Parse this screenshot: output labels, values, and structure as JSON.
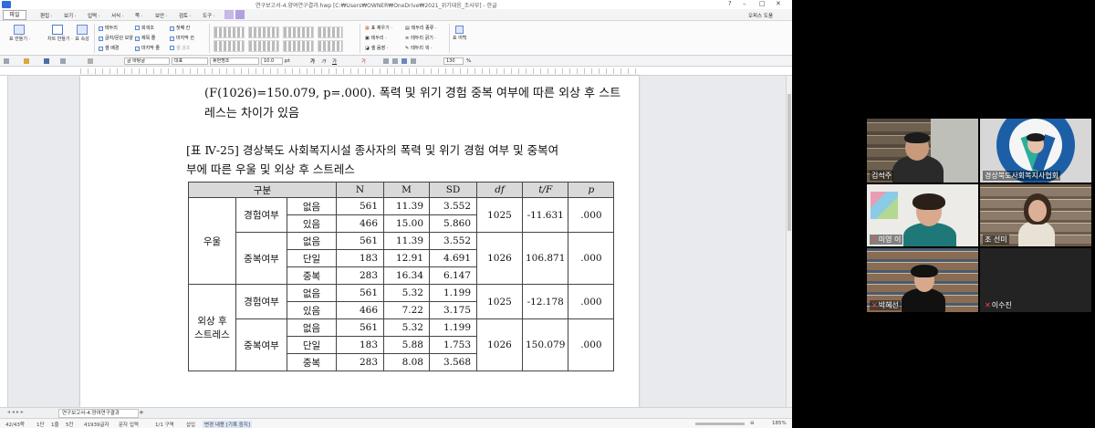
{
  "editor": {
    "window_title": "연구보고서-4.양여연구결과.hwp [C:₩Users₩OWNER₩OneDrive₩2021_위기대응_조사부] - 한글",
    "menu": {
      "file": "파일",
      "items": [
        "편집 ·",
        "보기 ·",
        "입력 ·",
        "서식 ·",
        "쪽 ·",
        "보안 ·",
        "검토 ·",
        "도구 ·"
      ],
      "right_label": "오피스 도움"
    },
    "ribbon": {
      "buttons": [
        "표 만들기 ·",
        "차트 만들기 ·",
        "표 속성"
      ],
      "checks_col1": [
        "테두리",
        "글자/문단 모양",
        "셀 배경"
      ],
      "checks_col2": [
        "회색조",
        "제목 줄",
        "마지막 줄"
      ],
      "checks_col3": [
        "첫째 칸",
        "마지막 칸",
        "셀 강조"
      ],
      "right_items": [
        "표 채우기 ·",
        "테두리 ·",
        "셀 음영 ·",
        "테두리 종류 ·",
        "테두리 굵기 ·",
        "테두리 색 ·"
      ],
      "last_button": "표 여백"
    },
    "formatbar": {
      "style": "글 바탕글",
      "lang": "대표",
      "font": "휴먼명조",
      "size": "10.0",
      "unit": "pt",
      "zoom": "130",
      "zoom_unit": "%"
    },
    "document": {
      "line1": "(F(1026)=150.079, p=.000). 폭력 및 위기 경험 중복 여부에 따른 외상 후 스트",
      "line2": "레스는 차이가 있음",
      "caption1": "[표 Ⅳ-25] 경상북도 사회복지시설 종사자의 폭력 및 위기 경험 여부 및 중복여",
      "caption2": "부에 따른 우울 및 외상 후 스트레스"
    },
    "table": {
      "headers": [
        "구분",
        "N",
        "M",
        "SD",
        "df",
        "t/F",
        "p"
      ],
      "groups": [
        {
          "label": "우울",
          "subgroups": [
            {
              "label": "경험여부",
              "rows": [
                {
                  "cat": "없음",
                  "n": "561",
                  "m": "11.39",
                  "sd": "3.552"
                },
                {
                  "cat": "있음",
                  "n": "466",
                  "m": "15.00",
                  "sd": "5.860"
                }
              ],
              "df": "1025",
              "tf": "-11.631",
              "p": ".000"
            },
            {
              "label": "중복여부",
              "rows": [
                {
                  "cat": "없음",
                  "n": "561",
                  "m": "11.39",
                  "sd": "3.552"
                },
                {
                  "cat": "단일",
                  "n": "183",
                  "m": "12.91",
                  "sd": "4.691"
                },
                {
                  "cat": "중복",
                  "n": "283",
                  "m": "16.34",
                  "sd": "6.147"
                }
              ],
              "df": "1026",
              "tf": "106.871",
              "p": ".000"
            }
          ]
        },
        {
          "label_line1": "외상 후",
          "label_line2": "스트레스",
          "subgroups": [
            {
              "label": "경험여부",
              "rows": [
                {
                  "cat": "없음",
                  "n": "561",
                  "m": "5.32",
                  "sd": "1.199"
                },
                {
                  "cat": "있음",
                  "n": "466",
                  "m": "7.22",
                  "sd": "3.175"
                }
              ],
              "df": "1025",
              "tf": "-12.178",
              "p": ".000"
            },
            {
              "label": "중복여부",
              "rows": [
                {
                  "cat": "없음",
                  "n": "561",
                  "m": "5.32",
                  "sd": "1.199"
                },
                {
                  "cat": "단일",
                  "n": "183",
                  "m": "5.88",
                  "sd": "1.753"
                },
                {
                  "cat": "중복",
                  "n": "283",
                  "m": "8.08",
                  "sd": "3.568"
                }
              ],
              "df": "1026",
              "tf": "150.079",
              "p": ".000"
            }
          ]
        }
      ]
    },
    "doc_tab": "연구보고서-4.양여연구결과",
    "status": {
      "page": "42/43쪽",
      "section": "1단",
      "line": "1줄",
      "col": "5칸",
      "chars": "41939글자",
      "mode": "문자 입력",
      "sub_mode": "문자 입력",
      "section_no": "1/1 구역",
      "insert": "삽입",
      "track": "변경 내용 [기록 중지]",
      "zoom": "185%"
    }
  },
  "video": {
    "participants": [
      {
        "name": "김석주",
        "mic_muted": false,
        "active": true
      },
      {
        "name": "경상북도사회복지사협회",
        "mic_muted": false,
        "active": false
      },
      {
        "name": "미영 이",
        "mic_muted": true,
        "active": false
      },
      {
        "name": "조 선미",
        "mic_muted": false,
        "active": false
      },
      {
        "name": "박혜선",
        "mic_muted": true,
        "active": false
      },
      {
        "name": "이수진",
        "mic_muted": true,
        "active": false
      }
    ],
    "logo_ring_text": "GYEONGBUK ASSOCIATION OF SOCIAL WORKERS"
  }
}
